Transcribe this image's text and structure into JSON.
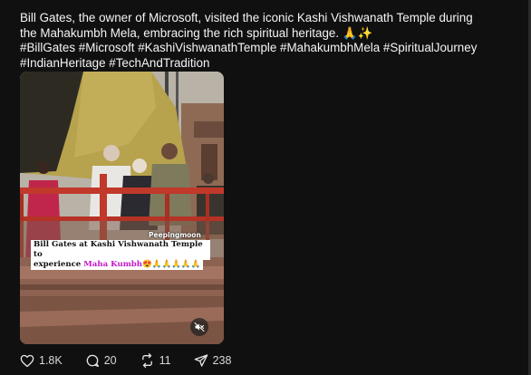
{
  "post": {
    "text_line1": "Bill Gates, the owner of Microsoft, visited the iconic Kashi Vishwanath Temple during",
    "text_line2": "the Mahakumbh Mela, embracing the rich spiritual heritage. 🙏✨",
    "hashtags_line1": "#BillGates #Microsoft #KashiVishwanathTemple #MahakumbhMela #SpiritualJourney",
    "hashtags_line2": "#IndianHeritage #TechAndTradition"
  },
  "video": {
    "watermark": "Peepingmoon",
    "caption_line1": "Bill Gates at Kashi Vishwanath Temple to",
    "caption_line2_prefix": "experience ",
    "caption_line2_accent": "Maha Kumbh",
    "caption_line2_suffix": "😍🙏🙏🙏🙏🙏",
    "accent_color": "#c218c7",
    "muted": true
  },
  "actions": {
    "likes": "1.8K",
    "comments": "20",
    "reposts": "11",
    "shares": "238"
  },
  "icons": {
    "like": "heart-icon",
    "comment": "comment-bubble-icon",
    "repost": "repost-arrows-icon",
    "share": "send-plane-icon",
    "mute": "speaker-muted-icon"
  }
}
